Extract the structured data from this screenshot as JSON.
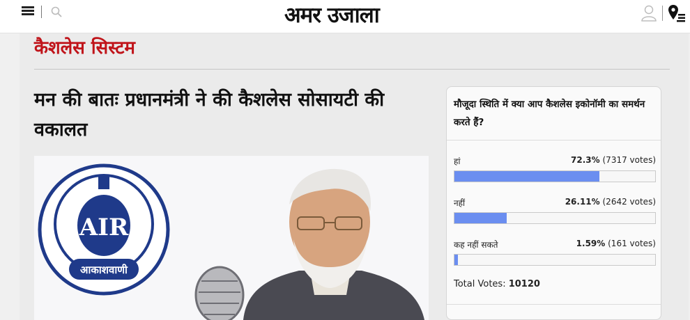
{
  "header": {
    "logo": "अमर उजाला",
    "icons": [
      "menu-icon",
      "search-icon",
      "user-icon",
      "location-icon"
    ]
  },
  "section": {
    "title": "कैशलेस सिस्टम"
  },
  "article": {
    "headline": "मन की बातः प्रधानमंत्री ने की कैशलेस सोसायटी की वकालत",
    "image": {
      "logo_text": "आकाशवाणी",
      "logo_initials": "AIR"
    }
  },
  "poll": {
    "question": "मौजूदा स्थिति में क्या आप कैशलेस इकोनॉमी का समर्थन करते हैं?",
    "options": [
      {
        "label": "हां",
        "percent": "72.3%",
        "votes": "(7317 votes)",
        "fraction": 0.723
      },
      {
        "label": "नहीं",
        "percent": "26.11%",
        "votes": "(2642 votes)",
        "fraction": 0.2611
      },
      {
        "label": "कह नहीं सकते",
        "percent": "1.59%",
        "votes": "(161 votes)",
        "fraction": 0.0159
      }
    ],
    "total_label": "Total Votes: ",
    "total_value": "10120",
    "bar_color": "#6b8ef0"
  },
  "colors": {
    "section_title": "#c0141a"
  }
}
